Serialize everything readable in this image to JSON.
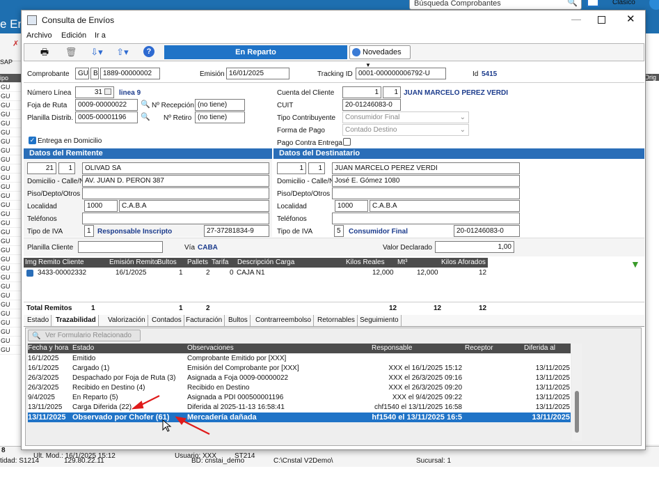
{
  "background": {
    "app_title_partial": "e Env",
    "search_placeholder": "Búsqueda Comprobantes",
    "view_label": "Clásico",
    "left_col_header": "ipo",
    "left_col_values": [
      "GU",
      "GU",
      "GU",
      "GU",
      "GU",
      "GU",
      "GU",
      "GU",
      "GU",
      "GU",
      "GU",
      "GU",
      "GU",
      "GU",
      "GU",
      "GU",
      "GU",
      "GU",
      "GU",
      "GU",
      "GU",
      "GU",
      "GU",
      "GU",
      "GU",
      "GU",
      "GU",
      "GU",
      "GU",
      "GU",
      "GU"
    ],
    "left_small_label": "SAP",
    "right_col_header": "Orig",
    "status_row1": "8",
    "status_row2": [
      "tidad: S1214",
      "129.80.22.11",
      "BD: cnstai_demo",
      "C:\\Cnstal V2Demo\\",
      "Sucursal: 1"
    ]
  },
  "window": {
    "title": "Consulta de Envíos",
    "menus": [
      "Archivo",
      "Edición",
      "Ir a"
    ]
  },
  "toolbar": {
    "status_label": "En Reparto",
    "novedades_label": "Novedades"
  },
  "header": {
    "comprobante_label": "Comprobante",
    "comp_tipo": "GU",
    "comp_letra": "B",
    "comp_numero": "1889-00000002",
    "emision_label": "Emisión",
    "emision": "16/01/2025",
    "tracking_label": "Tracking ID",
    "tracking": "0001-000000006792-U",
    "id_label": "Id",
    "id_value": "5415"
  },
  "left_info": {
    "numero_linea_label": "Número Línea",
    "numero_linea": "31",
    "linea_name": "linea 9",
    "foja_label": "Foja de Ruta",
    "foja": "0009-00000022",
    "nro_recepcion_label": "Nº Recepción",
    "nro_recepcion": "(no tiene)",
    "planilla_label": "Planilla Distrib.",
    "planilla": "0005-00001196",
    "nro_retiro_label": "Nº Retiro",
    "nro_retiro": "(no tiene)",
    "entrega_domicilio_label": "Entrega en Domicilio"
  },
  "right_info": {
    "cuenta_label": "Cuenta del Cliente",
    "cuenta_a": "1",
    "cuenta_b": "1",
    "cuenta_name": "JUAN MARCELO PEREZ VERDI",
    "cuit_label": "CUIT",
    "cuit": "20-01246083-0",
    "tipo_contrib_label": "Tipo Contribuyente",
    "tipo_contrib": "Consumidor Final",
    "forma_pago_label": "Forma de Pago",
    "forma_pago": "Contado Destino",
    "pago_contra_label": "Pago Contra Entrega"
  },
  "remitente": {
    "section": "Datos del Remitente",
    "cod_a": "21",
    "cod_b": "1",
    "nombre": "OLIVAD SA",
    "domicilio_label": "Domicilio - Calle/Nº",
    "domicilio": "AV. JUAN D. PERON 387",
    "piso_label": "Piso/Depto/Otros",
    "piso": "",
    "localidad_label": "Localidad",
    "cp": "1000",
    "localidad": "C.A.B.A",
    "telefonos_label": "Teléfonos",
    "telefonos": "",
    "iva_label": "Tipo de IVA",
    "iva_code": "1",
    "iva_name": "Responsable Inscripto",
    "cuit": "27-37281834-9"
  },
  "destinatario": {
    "section": "Datos del Destinatario",
    "cod_a": "1",
    "cod_b": "1",
    "nombre": "JUAN MARCELO PEREZ VERDI",
    "domicilio_label": "Domicilio - Calle/Nº",
    "domicilio": "José E. Gómez 1080",
    "piso_label": "Piso/Depto/Otros",
    "piso": "",
    "localidad_label": "Localidad",
    "cp": "1000",
    "localidad": "C.A.B.A",
    "telefonos_label": "Teléfonos",
    "telefonos": "",
    "iva_label": "Tipo de IVA",
    "iva_code": "5",
    "iva_name": "Consumidor Final",
    "cuit": "20-01246083-0"
  },
  "extra": {
    "planilla_cliente_label": "Planilla Cliente",
    "planilla_cliente": "",
    "via_label": "Vía",
    "via": "CABA",
    "valor_label": "Valor Declarado",
    "valor": "1,00"
  },
  "remitos": {
    "headers": [
      "Img",
      "Remito Cliente",
      "Emisión Remito",
      "Bultos",
      "Pallets",
      "Tarifa",
      "Descripción Carga",
      "Kilos Reales",
      "Mt³",
      "Kilos Aforados"
    ],
    "row": {
      "remito": "3433-00002332",
      "emision": "16/1/2025",
      "bultos": "1",
      "pallets": "2",
      "tarifa": "0",
      "descripcion": "CAJA N1",
      "kilos": "12,000",
      "mt3": "12,000",
      "aforados": "12"
    },
    "total_label": "Total Remitos",
    "totals": [
      "1",
      "1",
      "2",
      "12",
      "12",
      "12"
    ]
  },
  "tabs": [
    "Estado",
    "Trazabilidad",
    "Valorización",
    "Contados",
    "Facturación",
    "Bultos",
    "Contrarreembolso",
    "Retornables",
    "Seguimiento"
  ],
  "trace": {
    "button": "Ver Formulario Relacionado",
    "headers": [
      "Fecha y hora",
      "Estado",
      "Observaciones",
      "Responsable",
      "Receptor",
      "Diferida al"
    ],
    "rows": [
      {
        "fecha": "16/1/2025",
        "estado": "Emitido",
        "obs": "Comprobante Emitido por [XXX]",
        "resp": "",
        "receptor": "",
        "diferida": ""
      },
      {
        "fecha": "16/1/2025",
        "estado": "Cargado (1)",
        "obs": "Emisión del Comprobante por [XXX]",
        "resp": "XXX el 16/1/2025 15:12",
        "receptor": "",
        "diferida": "13/11/2025"
      },
      {
        "fecha": "26/3/2025",
        "estado": "Despachado por Foja de Ruta (3)",
        "obs": "Asignada a Foja 0009-00000022",
        "resp": "XXX el 26/3/2025 09:16",
        "receptor": "",
        "diferida": "13/11/2025"
      },
      {
        "fecha": "26/3/2025",
        "estado": "Recibido en Destino (4)",
        "obs": "Recibido en Destino",
        "resp": "XXX el 26/3/2025 09:20",
        "receptor": "",
        "diferida": "13/11/2025"
      },
      {
        "fecha": "9/4/2025",
        "estado": "En Reparto (5)",
        "obs": "Asignada a PDI 000500001196",
        "resp": "XXX el 9/4/2025 09:22",
        "receptor": "",
        "diferida": "13/11/2025"
      },
      {
        "fecha": "13/11/2025",
        "estado": "Carga Diferida (22)",
        "obs": "Diferida al 2025-11-13 16:58:41",
        "resp": "chf1540 el 13/11/2025 16:58",
        "receptor": "",
        "diferida": "13/11/2025"
      },
      {
        "fecha": "13/11/2025",
        "estado": "Observado por Chofer (61)",
        "obs": "Mercadería dañada",
        "resp": "hf1540 el 13/11/2025 16:5",
        "receptor": "",
        "diferida": "13/11/2025"
      }
    ]
  },
  "win_status": {
    "ult_mod": "Ult. Mod.: 16/1/2025 15:12",
    "usuario": "Usuario: XXX",
    "st": "ST214"
  },
  "colors": {
    "accent": "#1f73c7",
    "section": "#2a6eb8",
    "dark_header": "#4c4c4c",
    "annotation_arrow": "#e01b1b"
  }
}
